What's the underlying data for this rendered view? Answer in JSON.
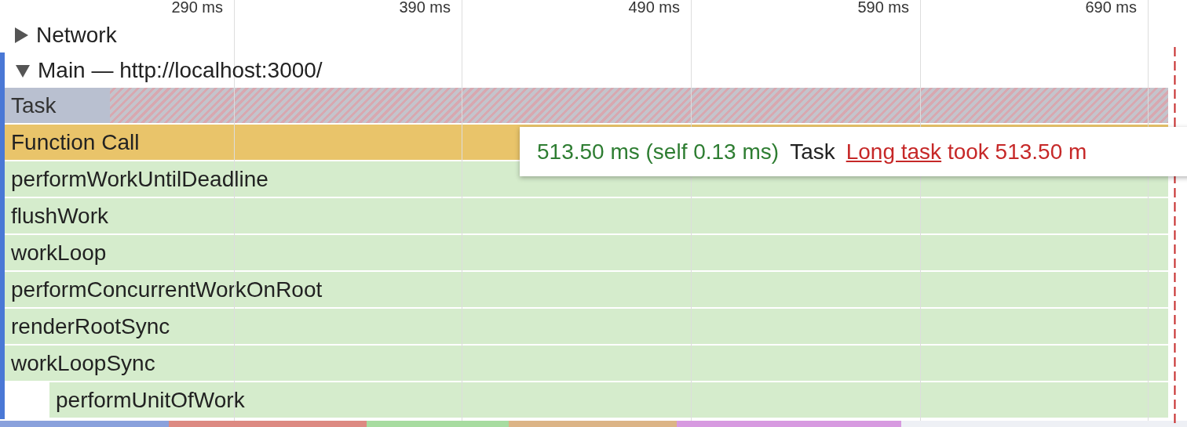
{
  "ruler": {
    "ticks": [
      "290 ms",
      "390 ms",
      "490 ms",
      "590 ms",
      "690 ms"
    ]
  },
  "tracks": [
    {
      "label": "Network",
      "expanded": false,
      "selected": false
    },
    {
      "label": "Main — http://localhost:3000/",
      "expanded": true,
      "selected": true
    }
  ],
  "flame": [
    {
      "label": "Task",
      "kind": "task"
    },
    {
      "label": "Function Call",
      "kind": "function-call"
    },
    {
      "label": "performWorkUntilDeadline",
      "kind": "script"
    },
    {
      "label": "flushWork",
      "kind": "script"
    },
    {
      "label": "workLoop",
      "kind": "script"
    },
    {
      "label": "performConcurrentWorkOnRoot",
      "kind": "script"
    },
    {
      "label": "renderRootSync",
      "kind": "script"
    },
    {
      "label": "workLoopSync",
      "kind": "script"
    },
    {
      "label": "performUnitOfWork",
      "kind": "script-offset"
    }
  ],
  "tooltip": {
    "duration": "513.50 ms (self 0.13 ms)",
    "name": "Task",
    "warning_link": "Long task",
    "warning_text": "took 513.50 m"
  },
  "summary_strip": [
    {
      "color": "#8aa1dc"
    },
    {
      "color": "#dd8a82"
    },
    {
      "color": "#a7dca0"
    },
    {
      "color": "#dcb486"
    },
    {
      "color": "#d79ae0"
    },
    {
      "color": "#eef0f5"
    }
  ]
}
